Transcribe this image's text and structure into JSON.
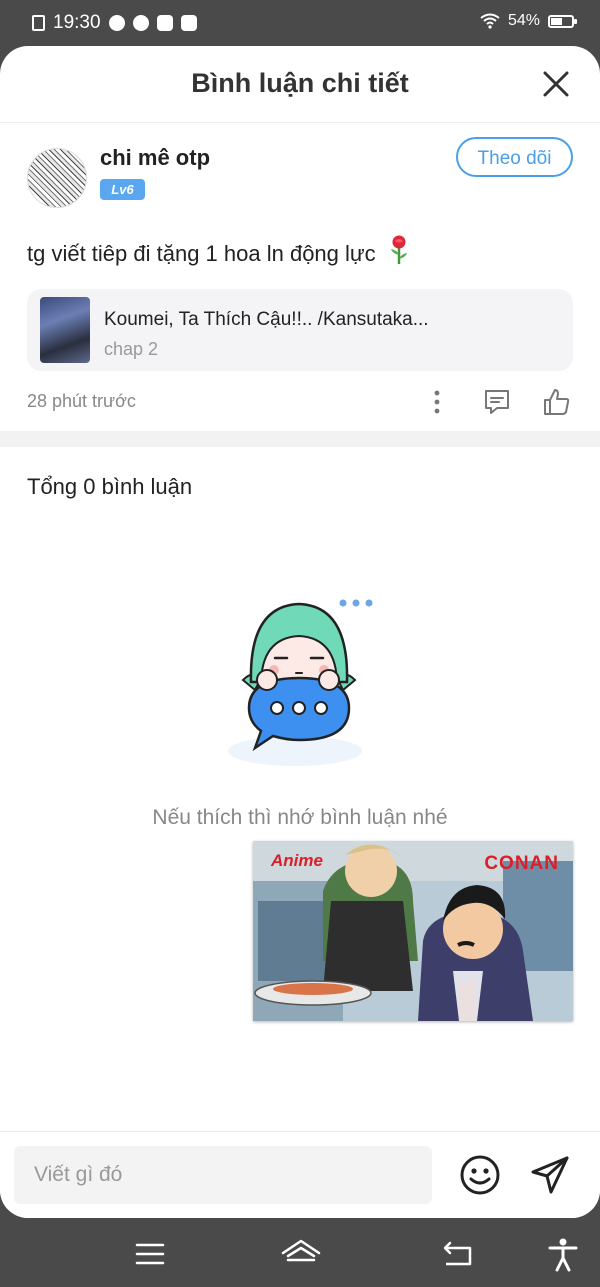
{
  "status_bar": {
    "time": "19:30",
    "battery": "54%",
    "battery_level": 0.54
  },
  "header": {
    "title": "Bình luận chi tiết"
  },
  "comment": {
    "username": "chi mê otp",
    "level": "Lv6",
    "follow_label": "Theo dõi",
    "text": "tg viết tiêp đi tặng 1 hoa ln động lực",
    "story_title": "Koumei, Ta Thích Cậu!!.. /Kansutaka...",
    "story_chapter": "chap 2",
    "time_ago": "28 phút trước"
  },
  "replies": {
    "total": "Tổng 0 bình luận",
    "empty_message": "Nếu thích thì nhớ bình luận nhé"
  },
  "ad": {
    "brand_left": "Anime",
    "brand_right": "CONAN"
  },
  "input": {
    "placeholder": "Viết gì đó"
  },
  "colors": {
    "accent": "#4a9fe8",
    "level_badge": "#5aa6ef",
    "illus_hair": "#6fd9b8",
    "illus_bubble": "#3d8ff0"
  }
}
